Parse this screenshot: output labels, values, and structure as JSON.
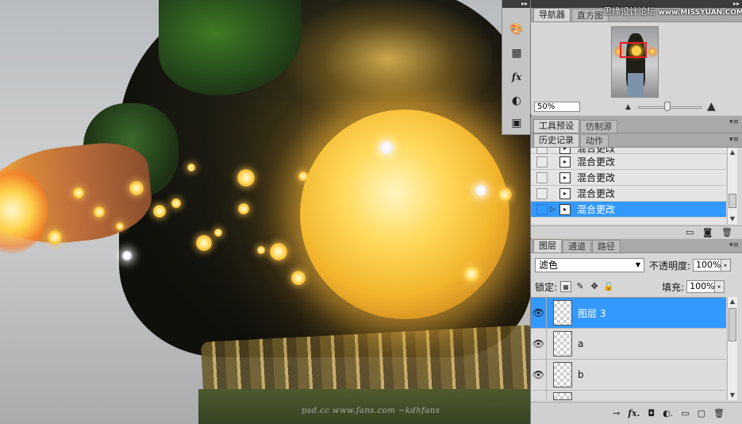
{
  "watermark": {
    "site_text": "思缘设计论坛",
    "site_url": "www.MISSYUAN.COM",
    "canvas_text": "psd.cc  www.fans.com  ~kdhfans"
  },
  "toolstrip": {
    "collapse_glyph": "▸▸",
    "buttons": [
      {
        "icon": "palette-icon",
        "glyph": "🎨"
      },
      {
        "icon": "swatches-icon",
        "glyph": "▦"
      },
      {
        "icon": "styles-fx-icon",
        "glyph": "fx"
      },
      {
        "icon": "adjustments-icon",
        "glyph": "◐"
      },
      {
        "icon": "masks-icon",
        "glyph": "▣"
      }
    ]
  },
  "navigator": {
    "tabs": [
      "导航器",
      "直方图"
    ],
    "menu_glyph": "▾≡",
    "zoom_value": "50%",
    "zoom_out_glyph": "▲",
    "zoom_in_glyph": "▲"
  },
  "tool_presets": {
    "tabs": [
      "工具预设",
      "仿制源"
    ],
    "menu_glyph": "▾≡"
  },
  "history": {
    "tabs": [
      "历史记录",
      "动作"
    ],
    "menu_glyph": "▾≡",
    "partial_item": "混合更改",
    "items": [
      {
        "label": "混合更改",
        "selected": false
      },
      {
        "label": "混合更改",
        "selected": false
      },
      {
        "label": "混合更改",
        "selected": false
      },
      {
        "label": "混合更改",
        "selected": true
      }
    ],
    "footer_icons": [
      "new-document-from-state-icon",
      "snapshot-camera-icon",
      "trash-icon"
    ],
    "footer_glyphs": [
      "▭",
      "◙",
      "🗑"
    ]
  },
  "layers": {
    "tabs": [
      "图层",
      "通道",
      "路径"
    ],
    "menu_glyph": "▾≡",
    "blend_mode": "滤色",
    "opacity_label": "不透明度:",
    "opacity_value": "100%",
    "lock_label": "锁定:",
    "fill_label": "填充:",
    "fill_value": "100%",
    "items": [
      {
        "name": "图层 3",
        "visible": true,
        "selected": true
      },
      {
        "name": "a",
        "visible": true,
        "selected": false
      },
      {
        "name": "b",
        "visible": true,
        "selected": false
      }
    ],
    "footer_icons": [
      "link-icon",
      "fx-icon",
      "mask-icon",
      "adjustment-layer-icon",
      "group-folder-icon",
      "new-layer-icon",
      "trash-icon"
    ],
    "footer_glyphs": [
      "⊸",
      "fx.",
      "◘",
      "◐.",
      "▭",
      "▢",
      "🗑"
    ]
  }
}
